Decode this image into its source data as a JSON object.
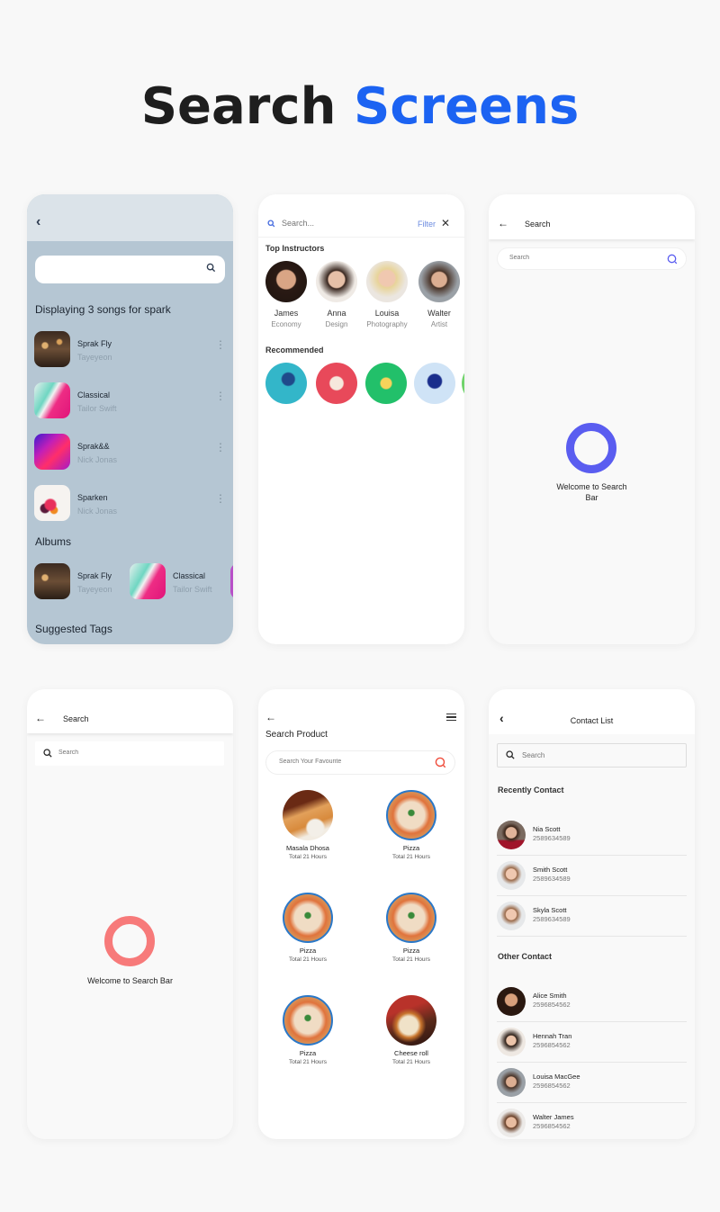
{
  "title": {
    "part1": "Search",
    "part2": "Screens",
    "accent_color": "#1c63f2"
  },
  "screen_music": {
    "back_icon": "chevron-left-icon",
    "search": {
      "value": "",
      "placeholder": "",
      "icon": "search-icon"
    },
    "heading": "Displaying 3 songs for spark",
    "songs": [
      {
        "name": "Sprak Fly",
        "artist": "Tayeyeon"
      },
      {
        "name": "Classical",
        "artist": "Tailor Swift"
      },
      {
        "name": "Sprak&&",
        "artist": "Nick Jonas"
      },
      {
        "name": "Sparken",
        "artist": "Nick Jonas"
      }
    ],
    "albums_heading": "Albums",
    "albums": [
      {
        "name": "Sprak Fly",
        "artist": "Tayeyeon"
      },
      {
        "name": "Classical",
        "artist": "Tailor Swift"
      }
    ],
    "tags_heading": "Suggested Tags"
  },
  "screen_instructors": {
    "search": {
      "placeholder": "Search...",
      "icon": "search-icon"
    },
    "filter_label": "Filter",
    "close_icon": "close-icon",
    "top_heading": "Top Instructors",
    "instructors": [
      {
        "name": "James",
        "role": "Economy"
      },
      {
        "name": "Anna",
        "role": "Design"
      },
      {
        "name": "Louisa",
        "role": "Photography"
      },
      {
        "name": "Walter",
        "role": "Artist"
      }
    ],
    "recommended_heading": "Recommended"
  },
  "screen_search_purple": {
    "header_title": "Search",
    "search": {
      "placeholder": "Search"
    },
    "welcome": "Welcome to Search Bar",
    "accent_color": "#5a5df0"
  },
  "screen_search_red": {
    "header_title": "Search",
    "search": {
      "placeholder": "Search"
    },
    "welcome": "Welcome to Search Bar",
    "accent_color": "#f77a7a"
  },
  "screen_products": {
    "page_title": "Search Product",
    "search": {
      "placeholder": "Search Your Favourite"
    },
    "products": [
      {
        "name": "Masala Dhosa",
        "subtitle": "Total 21 Hours"
      },
      {
        "name": "Pizza",
        "subtitle": "Total 21 Hours"
      },
      {
        "name": "Pizza",
        "subtitle": "Total 21 Hours"
      },
      {
        "name": "Pizza",
        "subtitle": "Total 21 Hours"
      },
      {
        "name": "Pizza",
        "subtitle": "Total 21 Hours"
      },
      {
        "name": "Cheese roll",
        "subtitle": "Total 21 Hours"
      }
    ]
  },
  "screen_contacts": {
    "header_title": "Contact List",
    "search": {
      "placeholder": "Search"
    },
    "recent_heading": "Recently Contact",
    "recent": [
      {
        "name": "Nia Scott",
        "phone": "2589634589"
      },
      {
        "name": "Smith Scott",
        "phone": "2589634589"
      },
      {
        "name": "Skyla Scott",
        "phone": "2589634589"
      }
    ],
    "other_heading": "Other Contact",
    "other": [
      {
        "name": "Alice Smith",
        "phone": "2596854562"
      },
      {
        "name": "Hennah Tran",
        "phone": "2596854562"
      },
      {
        "name": "Louisa MacGee",
        "phone": "2596854562"
      },
      {
        "name": "Walter James",
        "phone": "2596854562"
      }
    ]
  }
}
